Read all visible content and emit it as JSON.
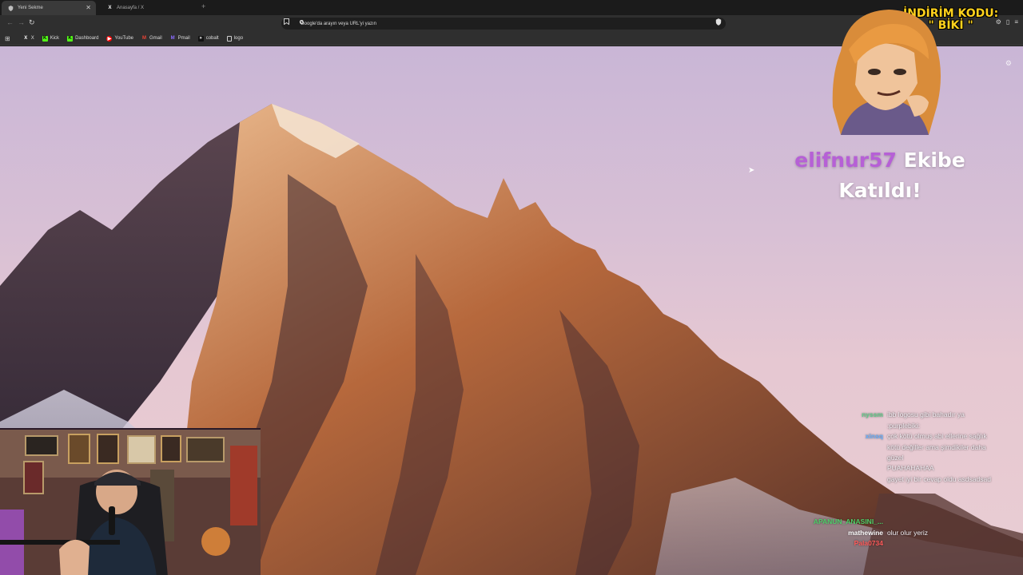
{
  "browser": {
    "tabs": [
      {
        "label": "Yeni Sekme",
        "active": true,
        "icon": "shield-tab-icon"
      },
      {
        "label": "Anasayfa / X",
        "active": false,
        "icon": "x-logo-icon"
      }
    ],
    "omnibox_placeholder": "Google'da arayın veya URL'yi yazın",
    "bookmarks": [
      {
        "label": "X",
        "icon": "x-logo-icon",
        "color": "#ffffff"
      },
      {
        "label": "Kick",
        "icon": "kick-icon",
        "color": "#53fc18"
      },
      {
        "label": "Dashboard",
        "icon": "kick-icon",
        "color": "#53fc18"
      },
      {
        "label": "YouTube",
        "icon": "youtube-icon",
        "color": "#ff0000"
      },
      {
        "label": "Gmail",
        "icon": "gmail-icon",
        "color": "#ea4335"
      },
      {
        "label": "Pmail",
        "icon": "proton-icon",
        "color": "#6d4aff"
      },
      {
        "label": "cobalt",
        "icon": "cobalt-icon",
        "color": "#ffffff"
      },
      {
        "label": "logo",
        "icon": "doc-icon",
        "color": "#cfcfcf"
      }
    ]
  },
  "stream_overlay": {
    "promo_line1": "İNDİRİM KODU:",
    "promo_line2": "\" BİKİ \"",
    "alert_username": "elifnur57",
    "alert_suffix": "Ekibe",
    "alert_line2": "Katıldı!",
    "accent_color": "#b660d6",
    "promo_color": "#ffd21c"
  },
  "chat": [
    {
      "user": "",
      "msg": "",
      "user_color": "#d86a8a"
    },
    {
      "user": "nyssm",
      "msg": "ibb logosu gibi bahadır ya",
      "user_color": "#5fd08a"
    },
    {
      "user": "",
      "msg": ":purplebiki:",
      "user_color": "#5fd08a"
    },
    {
      "user": "xinsq",
      "msg": "çok kötü olmuş abi ellerine sağlık",
      "user_color": "#66b0ff"
    },
    {
      "user": "",
      "msg": "kötü değiller ama şimdikiler daha",
      "user_color": "#3fc7b0"
    },
    {
      "user": "",
      "msg": "güzel",
      "user_color": "#3fc7b0"
    },
    {
      "user": "",
      "msg": "PUAHAHAHAA",
      "user_color": "#6b8cff"
    },
    {
      "user": "",
      "msg": "gayet iyi bir cevap oldu asdsadsad",
      "user_color": "#d56ad8"
    },
    {
      "user": "",
      "msg": "",
      "user_color": "#5fa8ff"
    },
    {
      "user": "",
      "msg": "",
      "user_color": "#a070e0"
    },
    {
      "user": "",
      "msg": "",
      "user_color": "#e06a9a"
    },
    {
      "user": "APANUN_ANASINI_...",
      "msg": "",
      "user_color": "#4fd06a"
    },
    {
      "user": "mathewine",
      "msg": "olur olur yeriz",
      "user_color": "#ffffff"
    },
    {
      "user": "Pala0734",
      "msg": "",
      "user_color": "#ff5a5a"
    }
  ]
}
